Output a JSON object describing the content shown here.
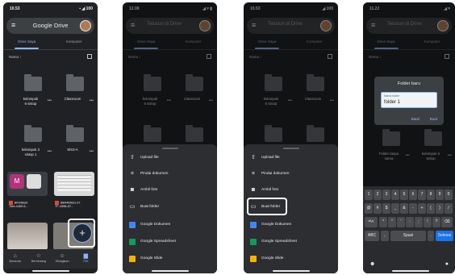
{
  "phone1": {
    "time": "10.53",
    "status_icons": "▪ ◢ 100",
    "app_title": "Google Drive",
    "tabs": [
      "Drive Saya",
      "Komputer"
    ],
    "sort_label": "Nama ↑",
    "folders": [
      {
        "name": "kelompok\n6 sistop"
      },
      {
        "name": "Classroom"
      },
      {
        "name": "kelompok 3\nsistop 1"
      },
      {
        "name": "SIS3-A"
      }
    ],
    "thumb_letter": "M",
    "file1": "BFb4Ba0-\n7fed-4469-6...",
    "file2": "BB4469EG-37\n7F-439B-87...",
    "nav": [
      "Beranda",
      "Berbintang",
      "Dibagikan",
      "File"
    ]
  },
  "phone2": {
    "time": "12.08",
    "status_icons": "◢ ▾ ▮",
    "search_placeholder": "Telusuri di Drive",
    "tabs": [
      "Drive Saya",
      "Komputer"
    ],
    "sort_label": "Nama ↑",
    "folders": [
      {
        "name": "kelompok\n6 sistop"
      },
      {
        "name": "Classroom"
      }
    ],
    "sheet_items": [
      "Upload file",
      "Pindai dokumen",
      "Ambil foto",
      "Buat folder",
      "Google Dokumen",
      "Google Spreadsheet",
      "Google Slide"
    ]
  },
  "phone3": {
    "time": "10.53",
    "status_icons": "◢ 100",
    "search_placeholder": "Telusuri di Drive",
    "tabs": [
      "Drive Saya",
      "Komputer"
    ],
    "sort_label": "Nama ↑",
    "folders": [
      {
        "name": "kelompok\n6 sistop"
      },
      {
        "name": "Classroom"
      }
    ],
    "sheet_items": [
      "Upload file",
      "Pindai dokumen",
      "Ambil foto",
      "Buat folder",
      "Google Dokumen",
      "Google Spreadsheet",
      "Google Slide"
    ]
  },
  "phone4": {
    "time": "11.22",
    "status_icons": "◢ ▾",
    "search_placeholder": "Telusuri di Drive",
    "tabs": [
      "Drive Saya",
      "Komputer"
    ],
    "sort_label": "Nama ↑",
    "folders": [
      {
        "name": "Folder tanpa\nnama"
      },
      {
        "name": "kelompok 6\nsistop"
      }
    ],
    "dialog": {
      "title": "Folder baru",
      "field_label": "Nama folder",
      "field_value": "folder 1",
      "cancel": "Batal",
      "create": "Buat"
    },
    "keyboard": {
      "row1": [
        "1",
        "2",
        "3",
        "4",
        "5",
        "6",
        "7",
        "8",
        "9",
        "0"
      ],
      "row2": [
        "@",
        "#",
        "$",
        "_",
        "&",
        "-",
        "+",
        "(",
        ")",
        "/"
      ],
      "row3": [
        "=\\<",
        "*",
        "\"",
        "'",
        ":",
        ";",
        "!",
        "?",
        "⌫"
      ],
      "row4": [
        "ABC",
        ",",
        "Spasi",
        ".",
        "Selesai"
      ]
    }
  }
}
